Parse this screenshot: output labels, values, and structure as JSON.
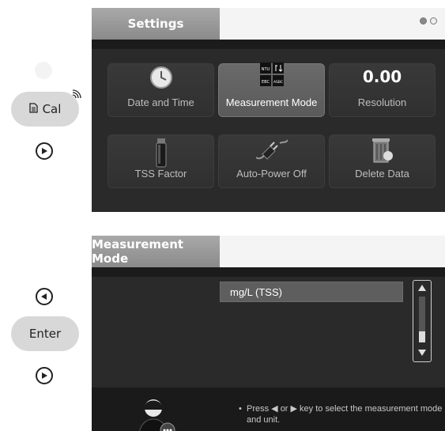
{
  "left_panel_1": {
    "cal_label": "Cal"
  },
  "left_panel_2": {
    "enter_label": "Enter"
  },
  "settings_screen": {
    "title": "Settings",
    "tiles": [
      {
        "label": "Date and Time",
        "icon": "clock-icon",
        "selected": false
      },
      {
        "label": "Measurement Mode",
        "icon": "measurement-mode-icon",
        "selected": true
      },
      {
        "label": "Resolution",
        "icon": "resolution-icon",
        "icon_text": "0.00",
        "selected": false
      },
      {
        "label": "TSS Factor",
        "icon": "tss-factor-icon",
        "selected": false
      },
      {
        "label": "Auto-Power Off",
        "icon": "power-plug-icon",
        "selected": false
      },
      {
        "label": "Delete Data",
        "icon": "trash-icon",
        "selected": false
      }
    ],
    "mode_icon_text": [
      "NTU",
      "EBC",
      "ASBC"
    ]
  },
  "measurement_screen": {
    "title": "Measurement Mode",
    "selected_option": "mg/L  (TSS)",
    "help_text": "Press ◀ or ▶ key to select the measurement mode and unit.",
    "help_icon": "user-help-icon"
  },
  "colors": {
    "screen_bg": "#2a2a2a",
    "tab_bg": "#999999",
    "selected_tile": "#626262"
  }
}
